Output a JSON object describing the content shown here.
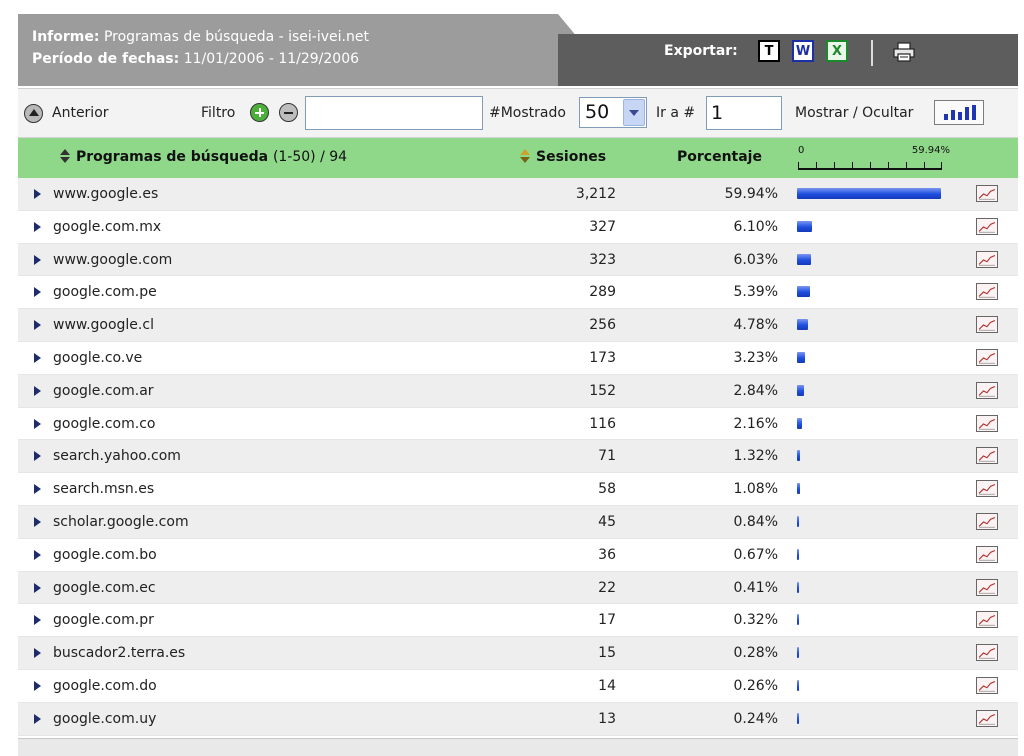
{
  "header": {
    "report_label": "Informe",
    "report_value": "Programas de búsqueda - isei-ivei.net",
    "period_label": "Período de fechas",
    "period_value": "11/01/2006 - 11/29/2006",
    "export_label": "Exportar:",
    "export_icons": [
      {
        "name": "text-export-icon",
        "glyph": "T"
      },
      {
        "name": "word-export-icon",
        "glyph": "W"
      },
      {
        "name": "excel-export-icon",
        "glyph": "X"
      }
    ],
    "print_icon": "printer-icon"
  },
  "toolbar": {
    "prev_label": "Anterior",
    "filter_label": "Filtro",
    "filter_value": "",
    "shown_label": "#Mostrado",
    "shown_value": "50",
    "goto_label": "Ir a #",
    "goto_value": "1",
    "toggle_label": "Mostrar / Ocultar"
  },
  "table": {
    "col_source": "Programas de búsqueda",
    "col_source_range": "(1-50) / 94",
    "col_sessions": "Sesiones",
    "col_percent": "Porcentaje",
    "scale_min": "0",
    "scale_max": "59.94%",
    "scale_max_value": 59.94,
    "bar_color": "#1f4fe0",
    "rows": [
      {
        "name": "www.google.es",
        "sessions": "3,212",
        "percent": "59.94%",
        "pct_value": 59.94
      },
      {
        "name": "google.com.mx",
        "sessions": "327",
        "percent": "6.10%",
        "pct_value": 6.1
      },
      {
        "name": "www.google.com",
        "sessions": "323",
        "percent": "6.03%",
        "pct_value": 6.03
      },
      {
        "name": "google.com.pe",
        "sessions": "289",
        "percent": "5.39%",
        "pct_value": 5.39
      },
      {
        "name": "www.google.cl",
        "sessions": "256",
        "percent": "4.78%",
        "pct_value": 4.78
      },
      {
        "name": "google.co.ve",
        "sessions": "173",
        "percent": "3.23%",
        "pct_value": 3.23
      },
      {
        "name": "google.com.ar",
        "sessions": "152",
        "percent": "2.84%",
        "pct_value": 2.84
      },
      {
        "name": "google.com.co",
        "sessions": "116",
        "percent": "2.16%",
        "pct_value": 2.16
      },
      {
        "name": "search.yahoo.com",
        "sessions": "71",
        "percent": "1.32%",
        "pct_value": 1.32
      },
      {
        "name": "search.msn.es",
        "sessions": "58",
        "percent": "1.08%",
        "pct_value": 1.08
      },
      {
        "name": "scholar.google.com",
        "sessions": "45",
        "percent": "0.84%",
        "pct_value": 0.84
      },
      {
        "name": "google.com.bo",
        "sessions": "36",
        "percent": "0.67%",
        "pct_value": 0.67
      },
      {
        "name": "google.com.ec",
        "sessions": "22",
        "percent": "0.41%",
        "pct_value": 0.41
      },
      {
        "name": "google.com.pr",
        "sessions": "17",
        "percent": "0.32%",
        "pct_value": 0.32
      },
      {
        "name": "buscador2.terra.es",
        "sessions": "15",
        "percent": "0.28%",
        "pct_value": 0.28
      },
      {
        "name": "google.com.do",
        "sessions": "14",
        "percent": "0.26%",
        "pct_value": 0.26
      },
      {
        "name": "google.com.uy",
        "sessions": "13",
        "percent": "0.24%",
        "pct_value": 0.24
      }
    ]
  }
}
